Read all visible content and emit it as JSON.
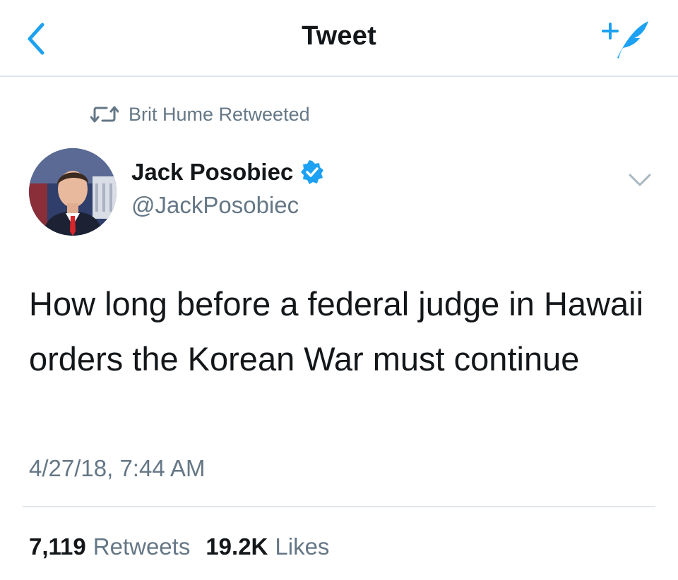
{
  "header": {
    "title": "Tweet",
    "back_icon": "chevron-left-icon",
    "compose_icon": "compose-tweet-icon"
  },
  "retweet_context": {
    "icon": "retweet-icon",
    "text": "Brit Hume Retweeted"
  },
  "author": {
    "name": "Jack Posobiec",
    "handle": "@JackPosobiec",
    "verified": true
  },
  "tweet": {
    "text": "How long before a federal judge in Hawaii orders the Korean War must continue",
    "timestamp": "4/27/18, 7:44 AM"
  },
  "stats": {
    "retweets_count": "7,119",
    "retweets_label": "Retweets",
    "likes_count": "19.2K",
    "likes_label": "Likes"
  },
  "colors": {
    "accent": "#1da1f2",
    "secondary_text": "#657786",
    "primary_text": "#14171a",
    "divider": "#e1e8ed"
  }
}
